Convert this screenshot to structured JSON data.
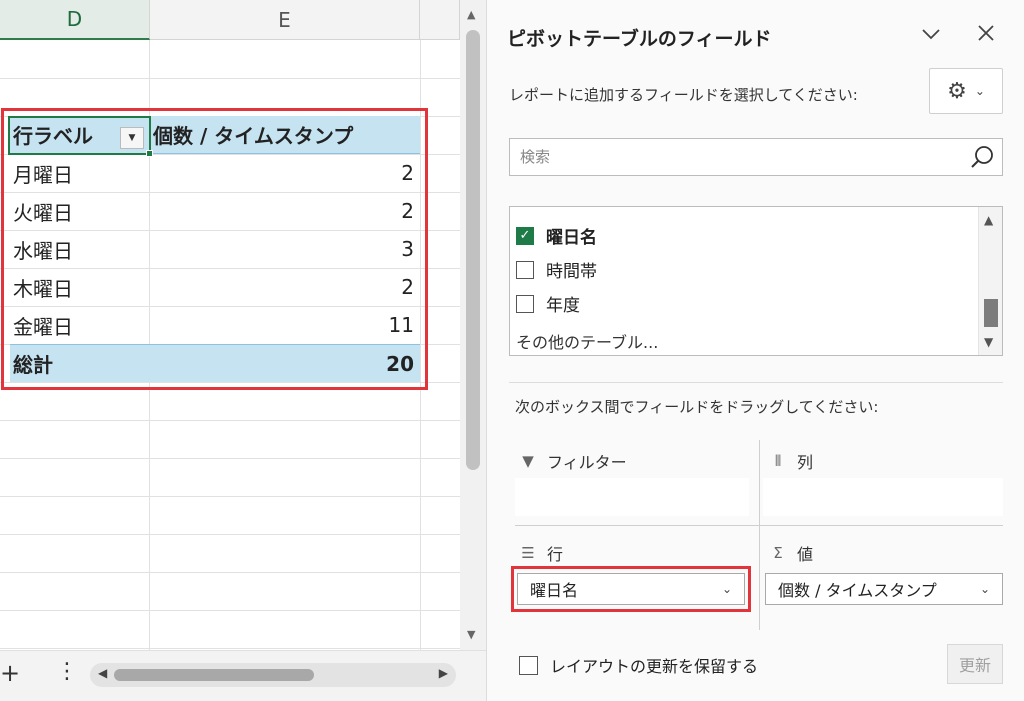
{
  "sheet": {
    "columns": [
      "D",
      "E"
    ],
    "pivot": {
      "header": {
        "row_label": "行ラベル",
        "value_label": "個数 / タイムスタンプ"
      },
      "rows": [
        {
          "label": "月曜日",
          "value": "2"
        },
        {
          "label": "火曜日",
          "value": "2"
        },
        {
          "label": "水曜日",
          "value": "3"
        },
        {
          "label": "木曜日",
          "value": "2"
        },
        {
          "label": "金曜日",
          "value": "11"
        }
      ],
      "total": {
        "label": "総計",
        "value": "20"
      }
    },
    "bottom": {
      "add_icon": "+",
      "more_icon": "⋮"
    }
  },
  "pane": {
    "title": "ピボットテーブルのフィールド",
    "subtitle": "レポートに追加するフィールドを選択してください:",
    "search_placeholder": "検索",
    "fields": [
      {
        "label": "曜日名",
        "checked": true
      },
      {
        "label": "時間帯",
        "checked": false
      },
      {
        "label": "年度",
        "checked": false
      }
    ],
    "more_tables": "その他のテーブル...",
    "drag_hint": "次のボックス間でフィールドをドラッグしてください:",
    "areas": {
      "filter": "フィルター",
      "columns": "列",
      "rows": "行",
      "values": "値"
    },
    "row_chip": "曜日名",
    "value_chip": "個数 / タイムスタンプ",
    "defer_label": "レイアウトの更新を保留する",
    "update_label": "更新"
  },
  "colors": {
    "pivot_header_bg": "#c6e3f2",
    "accent_green": "#1e7a46",
    "highlight_red": "#e1343b"
  },
  "icons": [
    "chevron-down-icon",
    "close-icon",
    "gear-icon",
    "search-icon",
    "filter-icon",
    "columns-icon",
    "rows-icon",
    "sigma-icon",
    "check-icon",
    "scroll-up-icon",
    "scroll-down-icon",
    "scroll-left-icon",
    "scroll-right-icon"
  ]
}
